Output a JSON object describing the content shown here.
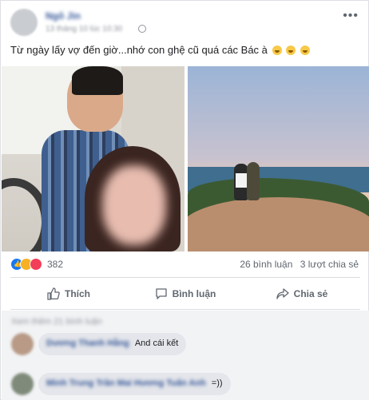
{
  "post": {
    "author": "Ngô Jin",
    "meta": "13 tháng 10 lúc 10:30",
    "text": "Từ ngày lấy vợ đến giờ...nhớ con ghệ cũ quá các Bác à",
    "more_label": "•••"
  },
  "stats": {
    "reaction_count": "382",
    "comments": "26 bình luận",
    "shares": "3 lượt chia sẻ"
  },
  "actions": {
    "like": "Thích",
    "comment": "Bình luận",
    "share": "Chia sẻ"
  },
  "comments": {
    "view_more": "Xem thêm 21 bình luận",
    "items": [
      {
        "name": "Dương Thanh Hằng",
        "text": "And cái kết"
      },
      {
        "name": "Minh Trung Trần Mai Hương Tuấn Anh",
        "text": "=))"
      }
    ]
  },
  "colors": {
    "link": "#365899",
    "like_blue": "#1877f2",
    "haha_yellow": "#f7b125",
    "love_red": "#f33e58"
  }
}
